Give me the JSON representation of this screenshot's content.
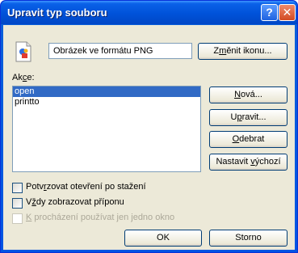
{
  "window": {
    "title": "Upravit typ souboru",
    "help_label": "?",
    "close_label": "✕"
  },
  "type": {
    "description": "Obrázek ve formátu PNG",
    "change_icon_label": "Změnit ikonu..."
  },
  "actions": {
    "label": "Akce:",
    "items": [
      "open",
      "printto"
    ],
    "selected": "open",
    "buttons": {
      "new": "Nová...",
      "edit": "Upravit...",
      "remove": "Odebrat",
      "default": "Nastavit výchozí"
    }
  },
  "options": {
    "confirm_open": "Potvrzovat otevření po stažení",
    "always_ext": "Vždy zobrazovat příponu",
    "same_window": "K procházení používat jen jedno okno"
  },
  "footer": {
    "ok": "OK",
    "cancel": "Storno"
  }
}
